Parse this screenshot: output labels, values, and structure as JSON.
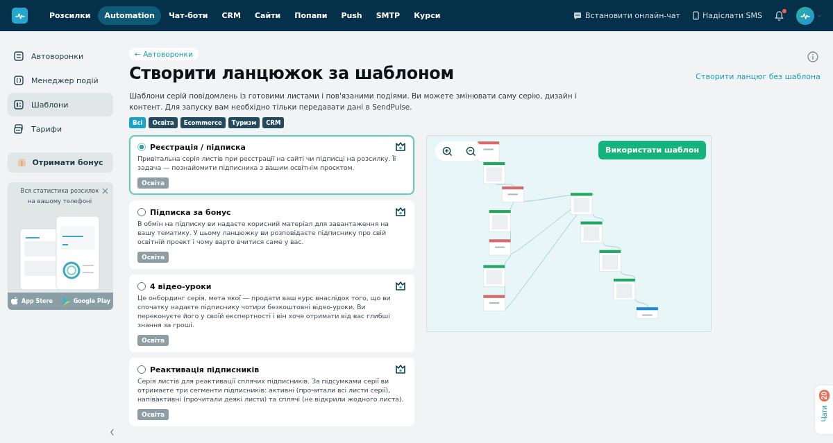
{
  "topnav": {
    "items": [
      {
        "label": "Розсилки",
        "selected": false
      },
      {
        "label": "Automation",
        "selected": true
      },
      {
        "label": "Чат-боти",
        "selected": false
      },
      {
        "label": "CRM",
        "selected": false
      },
      {
        "label": "Сайти",
        "selected": false
      },
      {
        "label": "Попапи",
        "selected": false
      },
      {
        "label": "Push",
        "selected": false
      },
      {
        "label": "SMTP",
        "selected": false
      },
      {
        "label": "Курси",
        "selected": false
      }
    ],
    "actions": [
      {
        "kind": "chat",
        "label": "Встановити онлайн-чат"
      },
      {
        "kind": "sms",
        "label": "Надіслати SMS"
      }
    ],
    "notifications": {
      "unread": true
    }
  },
  "sidebar": {
    "items": [
      {
        "kind": "funnel",
        "label": "Автоворонки",
        "selected": false
      },
      {
        "kind": "events",
        "label": "Менеджер подій",
        "selected": false
      },
      {
        "kind": "templates",
        "label": "Шаблони",
        "selected": true
      },
      {
        "kind": "tariffs",
        "label": "Тарифи",
        "selected": false
      }
    ],
    "bonus_button": "Отримати бонус",
    "promo": {
      "text": "Вся статистика розсилок на вашому телефоні",
      "stores": [
        "App Store",
        "Google Play"
      ]
    }
  },
  "breadcrumb": "← Автоворонки",
  "title": "Створити ланцюжок за шаблоном",
  "create_link": "Створити ланцюг без шаблона",
  "description": "Шаблони серій повідомлень із готовими листами і пов'язаними подіями. Ви можете змінювати саму серію, дизайн і контент. Для запуску вам необхідно тільки передавати дані в SendPulse.",
  "filters": [
    {
      "label": "Всі",
      "selected": true
    },
    {
      "label": "Освіта",
      "selected": false
    },
    {
      "label": "Ecommerce",
      "selected": false
    },
    {
      "label": "Туризм",
      "selected": false
    },
    {
      "label": "CRM",
      "selected": false
    }
  ],
  "templates": [
    {
      "title": "Реєстрація / підписка",
      "selected": true,
      "text": "Привітальна серія листів при реєстрації на сайті чи підписці на розсилку. Її задача — познайомити підписника з вашим освітнім проєктом.",
      "tag": "Освіта"
    },
    {
      "title": "Підписка за бонус",
      "selected": false,
      "text": "В обмін на підписку ви надаєте корисний матеріал для завантаження на вашу тематику. У цьому ланцюжку ви розповідаєте підписнику про свій освітній проект і чому варто вчитися саме у вас.",
      "tag": "Освіта"
    },
    {
      "title": "4 відео-уроки",
      "selected": false,
      "text": "Це онбординг серія, мета якої — продати ваш курс внаслідок того, що ви спочатку надаєте підписнику чотири безкоштовні відео-уроки. Ви переконуєте його у своїй експертності і він хоче отримати від вас глибші знання за гроші.",
      "tag": "Освіта"
    },
    {
      "title": "Реактивація підписників",
      "selected": false,
      "text": "Серія листів для реактивації сплячих підписників. За підсумками серії ви отримаєте три сегменти підписників: активні (прочитали всі листи серії), напівактивні (прочитали деякі листи) та сплячі (не відкрили жодного листа).",
      "tag": "Освіта"
    }
  ],
  "preview": {
    "use_button": "Використати шаблон"
  },
  "chats": {
    "label": "Чати",
    "count": "20"
  }
}
